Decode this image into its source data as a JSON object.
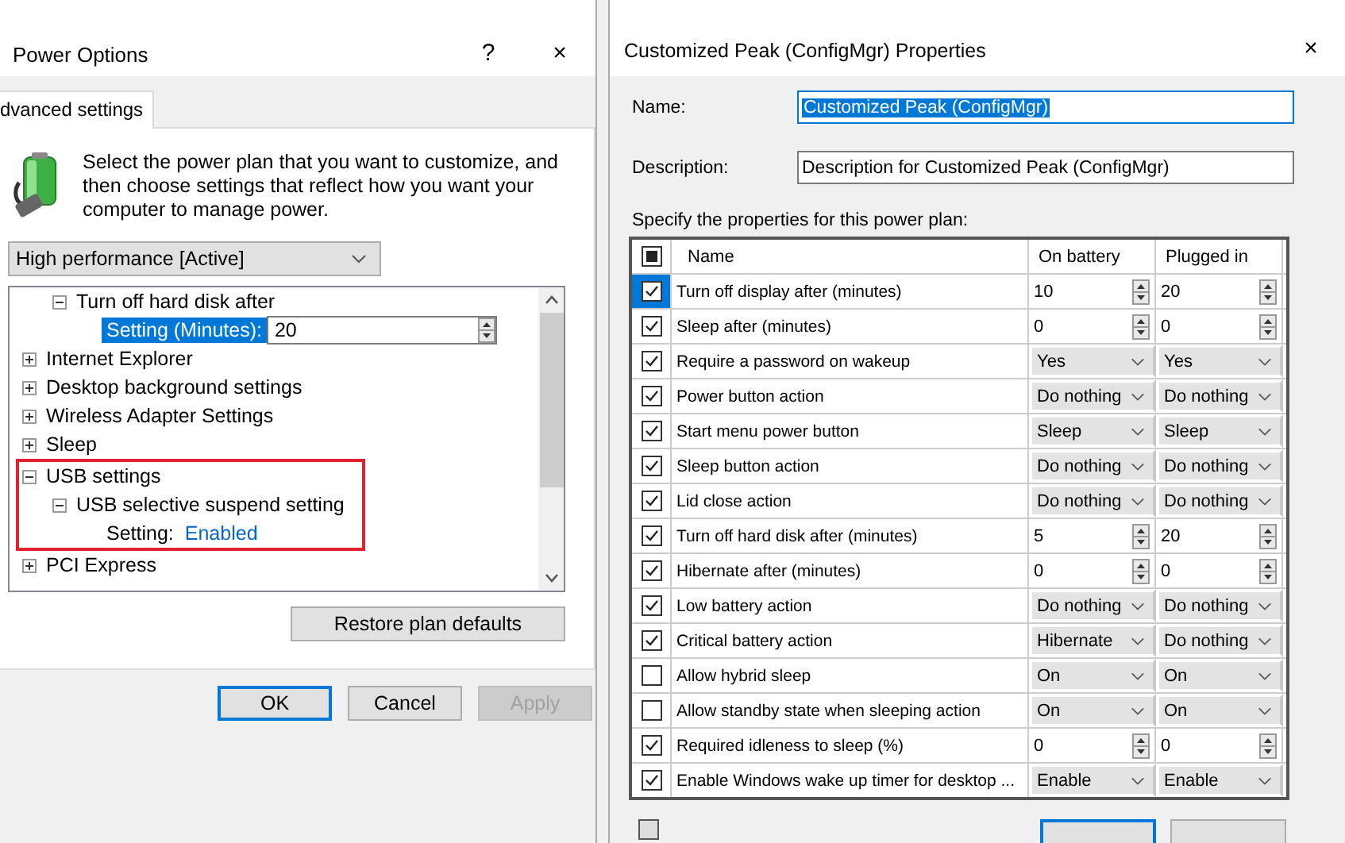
{
  "left_window": {
    "title": "Power Options",
    "help": "?",
    "close": "×",
    "tabs": [
      {
        "label": "dvanced settings",
        "selected": true
      }
    ],
    "description": "Select the power plan that you want to customize, and then choose settings that reflect how you want your computer to manage power.",
    "plan_dropdown": {
      "value": "High performance [Active]"
    },
    "tree": {
      "items": [
        {
          "kind": "continued",
          "children": [
            {
              "kind": "node",
              "label": "Turn off hard disk after",
              "expanded": true,
              "highlighted": false,
              "setting": {
                "kind": "spin",
                "label": "Setting (Minutes):",
                "value": "20",
                "selected": true
              }
            }
          ]
        },
        {
          "kind": "node",
          "label": "Internet Explorer",
          "expanded": false,
          "highlighted": false
        },
        {
          "kind": "node",
          "label": "Desktop background settings",
          "expanded": false,
          "highlighted": false
        },
        {
          "kind": "node",
          "label": "Wireless Adapter Settings",
          "expanded": false,
          "highlighted": false
        },
        {
          "kind": "node",
          "label": "Sleep",
          "expanded": false,
          "highlighted": false
        },
        {
          "kind": "node",
          "label": "USB settings",
          "expanded": true,
          "highlighted": true,
          "children": [
            {
              "kind": "node",
              "label": "USB selective suspend setting",
              "expanded": true,
              "highlighted": false,
              "setting": {
                "kind": "link",
                "label": "Setting:",
                "value": "Enabled",
                "selected": false
              }
            }
          ]
        },
        {
          "kind": "node",
          "label": "PCI Express",
          "expanded": false,
          "highlighted": false
        }
      ]
    },
    "restore_button": "Restore plan defaults",
    "buttons": [
      {
        "label": "OK",
        "disabled": false,
        "default": true
      },
      {
        "label": "Cancel",
        "disabled": false,
        "default": false
      },
      {
        "label": "Apply",
        "disabled": true,
        "default": false
      }
    ]
  },
  "right_window": {
    "title": "Customized Peak (ConfigMgr) Properties",
    "close": "×",
    "name_label": "Name:",
    "name_value": "Customized Peak (ConfigMgr)",
    "name_selected": true,
    "description_label": "Description:",
    "description_value": "Description for Customized Peak (ConfigMgr)",
    "table_caption": "Specify the properties for this power plan:",
    "columns": [
      "Name",
      "On battery",
      "Plugged in"
    ],
    "header_indeterminate": true,
    "footer_checkbox": {
      "checked": false
    },
    "rows": [
      {
        "name": "Turn off display after (minutes)",
        "checked": true,
        "selected": true,
        "on_battery": {
          "kind": "spin",
          "value": "10"
        },
        "plugged_in": {
          "kind": "spin",
          "value": "20"
        }
      },
      {
        "name": "Sleep after (minutes)",
        "checked": true,
        "selected": false,
        "on_battery": {
          "kind": "spin",
          "value": "0"
        },
        "plugged_in": {
          "kind": "spin",
          "value": "0"
        }
      },
      {
        "name": "Require a password on wakeup",
        "checked": true,
        "selected": false,
        "on_battery": {
          "kind": "dropdown",
          "value": "Yes"
        },
        "plugged_in": {
          "kind": "dropdown",
          "value": "Yes"
        }
      },
      {
        "name": "Power button action",
        "checked": true,
        "selected": false,
        "on_battery": {
          "kind": "dropdown",
          "value": "Do nothing"
        },
        "plugged_in": {
          "kind": "dropdown",
          "value": "Do nothing"
        }
      },
      {
        "name": "Start menu power button",
        "checked": true,
        "selected": false,
        "on_battery": {
          "kind": "dropdown",
          "value": "Sleep"
        },
        "plugged_in": {
          "kind": "dropdown",
          "value": "Sleep"
        }
      },
      {
        "name": "Sleep button action",
        "checked": true,
        "selected": false,
        "on_battery": {
          "kind": "dropdown",
          "value": "Do nothing"
        },
        "plugged_in": {
          "kind": "dropdown",
          "value": "Do nothing"
        }
      },
      {
        "name": "Lid close action",
        "checked": true,
        "selected": false,
        "on_battery": {
          "kind": "dropdown",
          "value": "Do nothing"
        },
        "plugged_in": {
          "kind": "dropdown",
          "value": "Do nothing"
        }
      },
      {
        "name": "Turn off hard disk after (minutes)",
        "checked": true,
        "selected": false,
        "on_battery": {
          "kind": "spin",
          "value": "5"
        },
        "plugged_in": {
          "kind": "spin",
          "value": "20"
        }
      },
      {
        "name": "Hibernate after (minutes)",
        "checked": true,
        "selected": false,
        "on_battery": {
          "kind": "spin",
          "value": "0"
        },
        "plugged_in": {
          "kind": "spin",
          "value": "0"
        }
      },
      {
        "name": "Low battery action",
        "checked": true,
        "selected": false,
        "on_battery": {
          "kind": "dropdown",
          "value": "Do nothing"
        },
        "plugged_in": {
          "kind": "dropdown",
          "value": "Do nothing"
        }
      },
      {
        "name": "Critical battery action",
        "checked": true,
        "selected": false,
        "on_battery": {
          "kind": "dropdown",
          "value": "Hibernate"
        },
        "plugged_in": {
          "kind": "dropdown",
          "value": "Do nothing"
        }
      },
      {
        "name": "Allow hybrid sleep",
        "checked": false,
        "selected": false,
        "on_battery": {
          "kind": "dropdown",
          "value": "On"
        },
        "plugged_in": {
          "kind": "dropdown",
          "value": "On"
        }
      },
      {
        "name": "Allow standby state when sleeping action",
        "checked": false,
        "selected": false,
        "on_battery": {
          "kind": "dropdown",
          "value": "On"
        },
        "plugged_in": {
          "kind": "dropdown",
          "value": "On"
        }
      },
      {
        "name": "Required idleness to sleep (%)",
        "checked": true,
        "selected": false,
        "on_battery": {
          "kind": "spin",
          "value": "0"
        },
        "plugged_in": {
          "kind": "spin",
          "value": "0"
        }
      },
      {
        "name": "Enable Windows wake up timer for desktop ...",
        "checked": true,
        "selected": false,
        "on_battery": {
          "kind": "dropdown",
          "value": "Enable"
        },
        "plugged_in": {
          "kind": "dropdown",
          "value": "Enable"
        }
      }
    ]
  }
}
